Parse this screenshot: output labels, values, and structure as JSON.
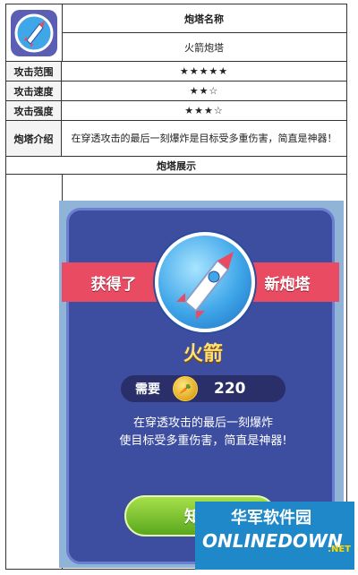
{
  "header": {
    "name_label": "炮塔名称",
    "name_value": "火箭炮塔"
  },
  "rows": [
    {
      "label": "攻击范围",
      "value": "★★★★★"
    },
    {
      "label": "攻击速度",
      "value": "★★☆"
    },
    {
      "label": "攻击强度",
      "value": "★★★☆"
    },
    {
      "label": "炮塔介绍",
      "value": "在穿透攻击的最后一刻爆炸是目标受多重伤害，简直是神器！"
    }
  ],
  "showcase_label": "炮塔展示",
  "game": {
    "ribbon_left": "获得了",
    "ribbon_right": "新炮塔",
    "tower_name": "火箭",
    "price_label": "需要",
    "price_value": "220",
    "description_line1": "在穿透攻击的最后一刻爆炸",
    "description_line2": "使目标受多重伤害，简直是神器!",
    "confirm_button": "知道"
  },
  "watermark": {
    "cn": "华军软件园",
    "en": "ONLINEDOWN",
    "dom": ".NET"
  },
  "colors": {
    "ribbon": "#e84b62",
    "panel": "#3d4ea0",
    "button": "#6ab82a"
  }
}
